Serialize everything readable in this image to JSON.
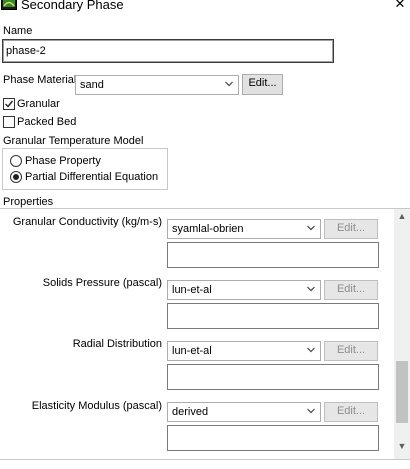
{
  "window": {
    "title": "Secondary Phase",
    "close_glyph": "✕",
    "app_icon": "fluent-app-icon"
  },
  "name": {
    "label": "Name",
    "value": "phase-2"
  },
  "material": {
    "label": "Phase Material",
    "value": "sand",
    "edit_label": "Edit..."
  },
  "options": {
    "granular": {
      "label": "Granular",
      "checked": true
    },
    "packed_bed": {
      "label": "Packed Bed",
      "checked": false
    }
  },
  "granular_temperature_model": {
    "label": "Granular Temperature Model",
    "options": [
      {
        "label": "Phase Property",
        "selected": false
      },
      {
        "label": "Partial Differential Equation",
        "selected": true
      }
    ]
  },
  "properties": {
    "label": "Properties",
    "items": [
      {
        "label": "Granular Conductivity (kg/m-s)",
        "value": "syamlal-obrien",
        "edit_label": "Edit..."
      },
      {
        "label": "Solids Pressure (pascal)",
        "value": "lun-et-al",
        "edit_label": "Edit..."
      },
      {
        "label": "Radial Distribution",
        "value": "lun-et-al",
        "edit_label": "Edit..."
      },
      {
        "label": "Elasticity Modulus (pascal)",
        "value": "derived",
        "edit_label": "Edit..."
      }
    ]
  },
  "icons": {
    "scroll_up": "▲",
    "scroll_down": "▼"
  }
}
